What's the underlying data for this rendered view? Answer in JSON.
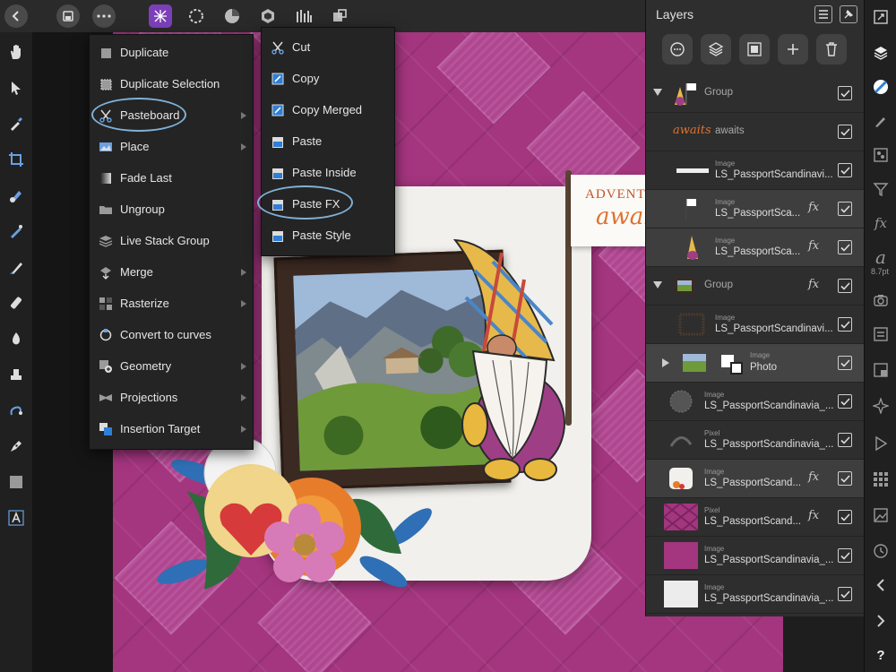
{
  "menu": {
    "items": [
      {
        "label": "Duplicate",
        "icon": "duplicate-icon",
        "submenu": false
      },
      {
        "label": "Duplicate Selection",
        "icon": "duplicate-selection-icon",
        "submenu": false
      },
      {
        "label": "Pasteboard",
        "icon": "scissors-icon",
        "submenu": true
      },
      {
        "label": "Place",
        "icon": "place-icon",
        "submenu": true
      },
      {
        "label": "Fade Last",
        "icon": "fade-icon",
        "submenu": false
      },
      {
        "label": "Ungroup",
        "icon": "folder-icon",
        "submenu": false
      },
      {
        "label": "Live Stack Group",
        "icon": "stack-icon",
        "submenu": false
      },
      {
        "label": "Merge",
        "icon": "merge-icon",
        "submenu": true
      },
      {
        "label": "Rasterize",
        "icon": "rasterize-icon",
        "submenu": true
      },
      {
        "label": "Convert to curves",
        "icon": "curves-icon",
        "submenu": false
      },
      {
        "label": "Geometry",
        "icon": "geometry-icon",
        "submenu": true
      },
      {
        "label": "Projections",
        "icon": "projections-icon",
        "submenu": true
      },
      {
        "label": "Insertion Target",
        "icon": "insertion-icon",
        "submenu": true
      }
    ]
  },
  "submenu": {
    "items": [
      {
        "label": "Cut",
        "icon": "scissors-icon"
      },
      {
        "label": "Copy",
        "icon": "copy-icon"
      },
      {
        "label": "Copy Merged",
        "icon": "copy-merged-icon"
      },
      {
        "label": "Paste",
        "icon": "paste-icon"
      },
      {
        "label": "Paste Inside",
        "icon": "paste-inside-icon"
      },
      {
        "label": "Paste FX",
        "icon": "paste-fx-icon"
      },
      {
        "label": "Paste Style",
        "icon": "paste-style-icon"
      }
    ]
  },
  "layers": {
    "title": "Layers",
    "fx_label": "fx",
    "rows": [
      {
        "type": "",
        "name": "Group",
        "kind": "group"
      },
      {
        "type": "",
        "name": "awaits",
        "kind": "text",
        "thumb_text": "awaits"
      },
      {
        "type": "Image",
        "name": "LS_PassportScandinavi...",
        "kind": "layer",
        "fx": false
      },
      {
        "type": "Image",
        "name": "LS_PassportSca...",
        "kind": "layer",
        "fx": true
      },
      {
        "type": "Image",
        "name": "LS_PassportSca...",
        "kind": "layer",
        "fx": true
      },
      {
        "type": "",
        "name": "Group",
        "kind": "group",
        "fx": true
      },
      {
        "type": "Image",
        "name": "LS_PassportScandinavi...",
        "kind": "layer",
        "fx": false
      },
      {
        "type": "Image",
        "name": "Photo",
        "kind": "layer",
        "fx": false
      },
      {
        "type": "Image",
        "name": "LS_PassportScandinavia_...",
        "kind": "layer",
        "fx": false
      },
      {
        "type": "Pixel",
        "name": "LS_PassportScandinavia_...",
        "kind": "layer",
        "fx": false
      },
      {
        "type": "Image",
        "name": "LS_PassportScand...",
        "kind": "layer",
        "fx": true
      },
      {
        "type": "Pixel",
        "name": "LS_PassportScand...",
        "kind": "layer",
        "fx": true
      },
      {
        "type": "Image",
        "name": "LS_PassportScandinavia_...",
        "kind": "layer",
        "fx": false
      },
      {
        "type": "Image",
        "name": "LS_PassportScandinavia_...",
        "kind": "layer",
        "fx": false
      }
    ]
  },
  "canvas": {
    "flag_line1": "ADVENTU",
    "flag_line2": "awai"
  },
  "rightrail": {
    "font_size": "8.7pt",
    "help": "?"
  },
  "colors": {
    "accent_circle": "#7fb1d6",
    "background": "#a4357f"
  }
}
